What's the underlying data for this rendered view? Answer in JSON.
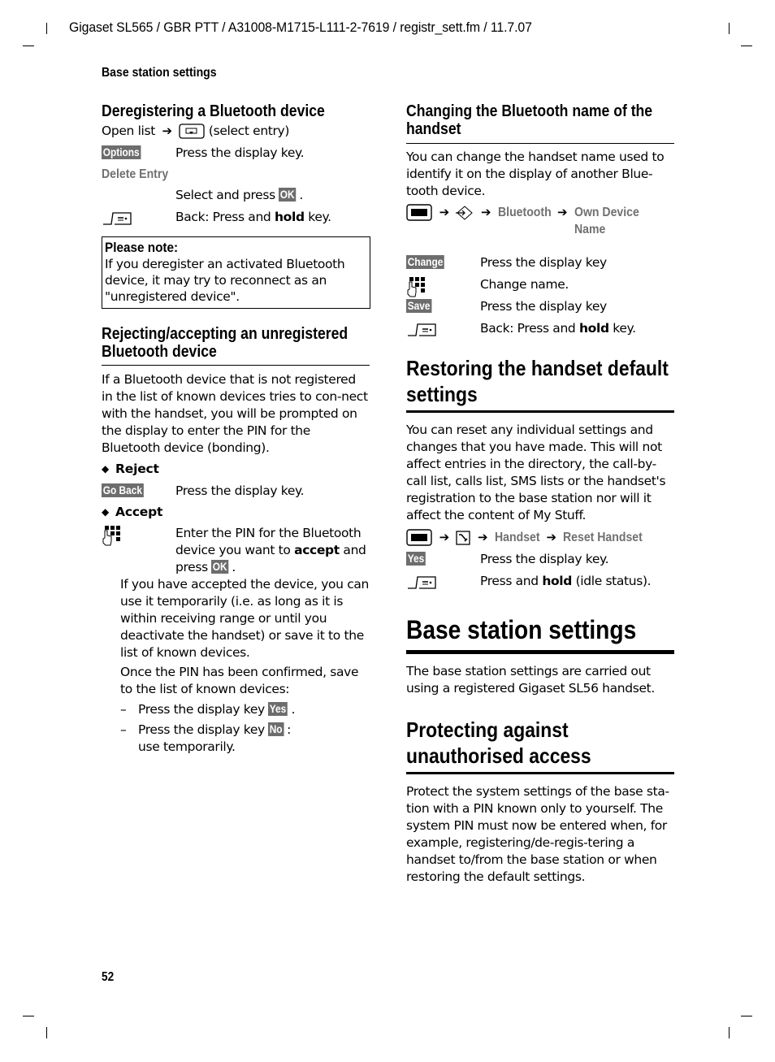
{
  "header": {
    "doc_ref": "Gigaset SL565 / GBR PTT / A31008-M1715-L111-2-7619 / registr_sett.fm / 11.7.07",
    "running_title": "Base station settings",
    "page_number": "52"
  },
  "left": {
    "deregister": {
      "title": "Deregistering a Bluetooth device",
      "open_list": "Open list",
      "select_entry": "(select entry)",
      "options_key": "Options",
      "options_text": "Press the display key.",
      "delete_entry": "Delete Entry",
      "select_press": "Select and press",
      "ok_key": "OK",
      "back_pre": "Back: Press and ",
      "back_bold": "hold",
      "back_post": " key."
    },
    "note": {
      "title": "Please note:",
      "text": "If you deregister an activated Bluetooth device, it may try to reconnect as an \"unregistered device\"."
    },
    "reject_accept": {
      "title": "Rejecting/accepting an unregistered Bluetooth device",
      "intro": "If a Bluetooth device that is not registered in the list of known devices tries to con-nect with the handset, you will be prompted on the display to enter the PIN for the Bluetooth device (bonding).",
      "reject_label": "Reject",
      "go_back_key": "Go Back",
      "go_back_text": "Press the display key.",
      "accept_label": "Accept",
      "pin_pre": "Enter the PIN for the Bluetooth device you want to ",
      "pin_bold": "accept",
      "pin_mid": " and press ",
      "ok_key": "OK",
      "para1": "If you have accepted the device, you can use it temporarily (i.e. as long as it is within receiving range or until you deactivate the handset) or save it to the list of known devices.",
      "para2": "Once the PIN has been confirmed, save to the list of known devices:",
      "dash1_pre": "Press the display key ",
      "yes_key": "Yes",
      "dash2_pre": "Press the display key ",
      "no_key": "No",
      "dash2_post": "use temporarily."
    }
  },
  "right": {
    "bt_name": {
      "title": "Changing the Bluetooth name of the handset",
      "intro": "You can change the handset name used to identify it on the display of another Blue-tooth device.",
      "path": [
        "Bluetooth",
        "Own Device Name"
      ],
      "change_key": "Change",
      "change_text": "Press the display key",
      "keypad_text": "Change name.",
      "save_key": "Save",
      "save_text": "Press the display key",
      "back_pre": "Back: Press and ",
      "back_bold": "hold",
      "back_post": " key."
    },
    "restore": {
      "title": "Restoring the handset default settings",
      "intro": "You can reset any individual settings and changes that you have made. This will not affect entries in the directory, the call-by-call list, calls list, SMS lists or the handset's registration to the base station nor will it affect the content of My Stuff.",
      "path": [
        "Handset",
        "Reset Handset"
      ],
      "yes_key": "Yes",
      "yes_text": "Press the display key.",
      "end_pre": "Press and ",
      "end_bold": "hold",
      "end_post": " (idle status)."
    },
    "base": {
      "title": "Base station settings",
      "intro": "The base station settings are carried out using a registered Gigaset SL56 handset."
    },
    "protect": {
      "title": "Protecting against unauthorised access",
      "intro": "Protect the system settings of the base sta-tion with a PIN known only to yourself. The system PIN must now be entered when, for example, registering/de-regis-tering a handset to/from the base station or when restoring the default settings."
    }
  },
  "symbols": {
    "arrow": "➔",
    "diamond": "◆",
    "dash": "–"
  }
}
